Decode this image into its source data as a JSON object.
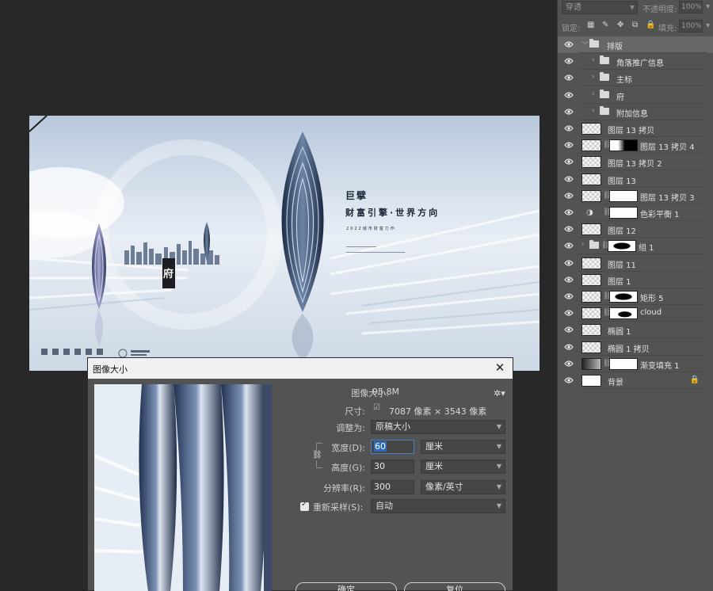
{
  "panel": {
    "blend_mode": "穿透",
    "opacity_label": "不透明度:",
    "opacity_value": "100%",
    "lock_label": "锁定:",
    "fill_label": "填充:",
    "fill_value": "100%"
  },
  "layers": [
    {
      "name": "排版",
      "kind": "group-open"
    },
    {
      "name": "角落推广信息",
      "kind": "subgroup"
    },
    {
      "name": "主标",
      "kind": "subgroup"
    },
    {
      "name": "府",
      "kind": "subgroup"
    },
    {
      "name": "附加信息",
      "kind": "subgroup"
    },
    {
      "name": "图层 13 拷贝",
      "kind": "pixel"
    },
    {
      "name": "图层 13 拷贝 4",
      "kind": "masked",
      "mask": "black"
    },
    {
      "name": "图层 13 拷贝 2",
      "kind": "pixel"
    },
    {
      "name": "图层 13",
      "kind": "pixel"
    },
    {
      "name": "图层 13 拷贝 3",
      "kind": "masked",
      "mask": "white"
    },
    {
      "name": "色彩平衡 1",
      "kind": "adjustment"
    },
    {
      "name": "图层 12",
      "kind": "pixel"
    },
    {
      "name": "组 1",
      "kind": "group-masked"
    },
    {
      "name": "图层 11",
      "kind": "pixel"
    },
    {
      "name": "图层 1",
      "kind": "pixel"
    },
    {
      "name": "矩形 5",
      "kind": "shape-masked",
      "mask": "rect5"
    },
    {
      "name": "cloud",
      "kind": "masked",
      "mask": "blob"
    },
    {
      "name": "椭圆 1",
      "kind": "shape"
    },
    {
      "name": "椭圆 1 拷贝",
      "kind": "shape"
    },
    {
      "name": "渐变填充 1",
      "kind": "gradient"
    },
    {
      "name": "背景",
      "kind": "background"
    }
  ],
  "poster": {
    "headline_1": "巨擘",
    "headline_2": "财富引擎·世界方向",
    "tagline": "2022城市财富力作",
    "center_char": "府"
  },
  "dialog": {
    "title": "图像大小",
    "image_size_label": "图像大小:",
    "image_size_value": "95.8M",
    "dimensions_label": "尺寸:",
    "dimensions_value": "7087 像素  ×  3543 像素",
    "fit_label": "调整为:",
    "fit_value": "原稿大小",
    "width_label": "宽度(D):",
    "width_value": "60",
    "width_unit": "厘米",
    "height_label": "高度(G):",
    "height_value": "30",
    "height_unit": "厘米",
    "resolution_label": "分辨率(R):",
    "resolution_value": "300",
    "resolution_unit": "像素/英寸",
    "resample_label": "重新采样(S):",
    "resample_checked": true,
    "resample_value": "自动",
    "ok_label": "确定",
    "reset_label": "复位"
  }
}
